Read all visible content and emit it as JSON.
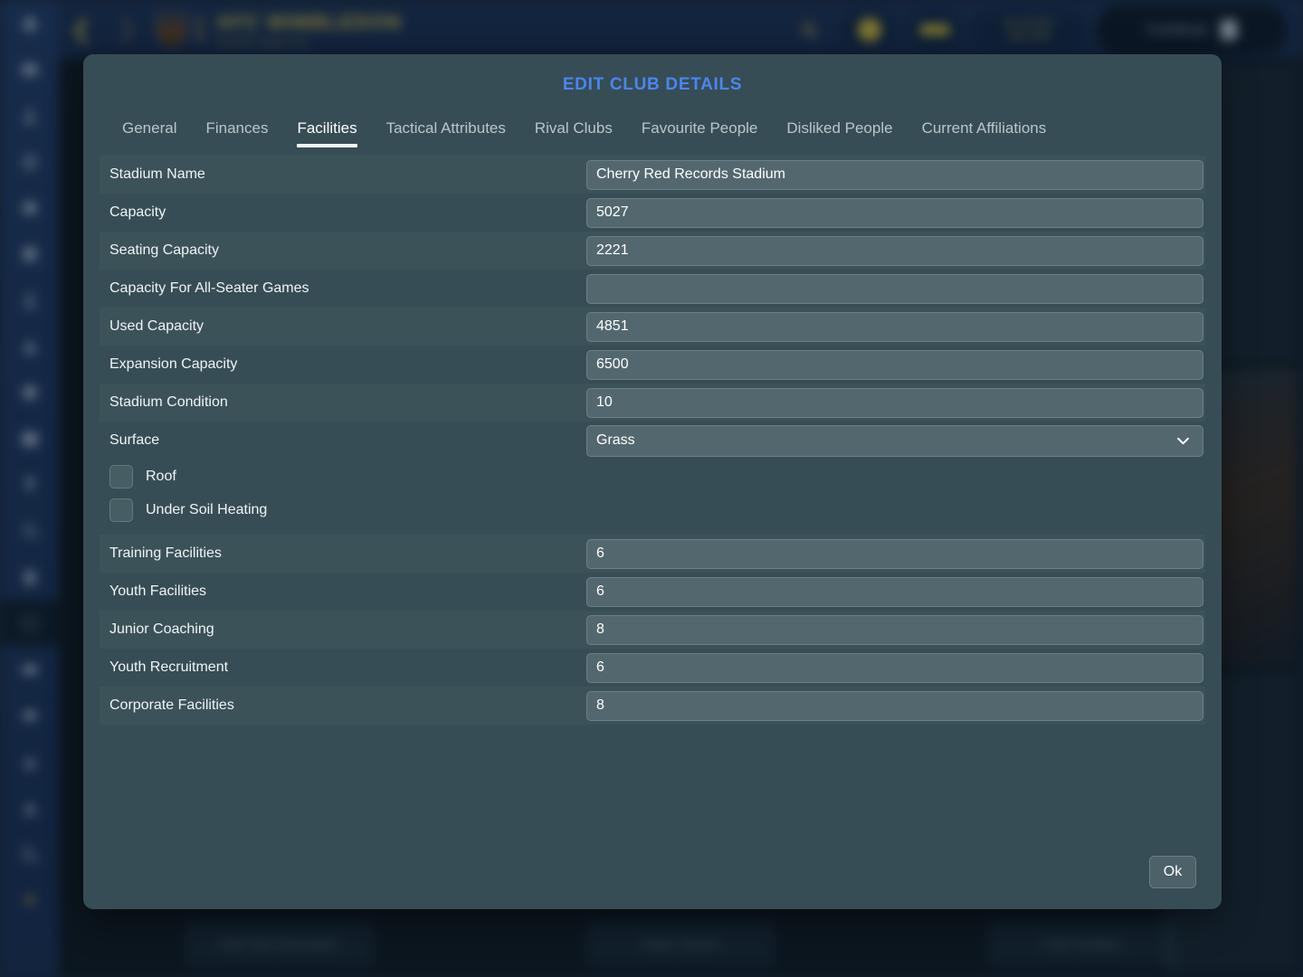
{
  "background": {
    "club_name": "AFC WIMBLEDON",
    "club_subtitle": "Sky Bet League One",
    "nav_back_icon": "chevron-left-icon",
    "nav_forward_icon": "chevron-right-icon",
    "search_icon": "search-icon",
    "date_line1": "15 Jul 2017",
    "date_line2": "Mon 15th",
    "continue_label": "Continue",
    "sidebar_icons": [
      "home-icon",
      "inbox-icon",
      "person-icon",
      "globe-icon",
      "squad-icon",
      "tactics-icon",
      "training-icon",
      "person-group-icon",
      "cone-icon",
      "shield-icon",
      "calendar-icon",
      "trophy-icon",
      "search-icon",
      "clipboard-icon",
      "club-icon",
      "tv-icon",
      "stadium-icon",
      "staff-icon",
      "scout-icon",
      "moon-icon",
      "settings-icon"
    ],
    "bottom_buttons": [
      "Edit Club Information",
      "Player Search",
      "Club Facilities"
    ]
  },
  "dialog": {
    "title": "EDIT CLUB DETAILS",
    "tabs": [
      {
        "label": "General",
        "active": false
      },
      {
        "label": "Finances",
        "active": false
      },
      {
        "label": "Facilities",
        "active": true
      },
      {
        "label": "Tactical Attributes",
        "active": false
      },
      {
        "label": "Rival Clubs",
        "active": false
      },
      {
        "label": "Favourite People",
        "active": false
      },
      {
        "label": "Disliked People",
        "active": false
      },
      {
        "label": "Current Affiliations",
        "active": false
      }
    ],
    "fields_top": [
      {
        "label": "Stadium Name",
        "value": "Cherry Red Records Stadium"
      },
      {
        "label": "Capacity",
        "value": "5027"
      },
      {
        "label": "Seating Capacity",
        "value": "2221"
      },
      {
        "label": "Capacity For All-Seater Games",
        "value": ""
      },
      {
        "label": "Used Capacity",
        "value": "4851"
      },
      {
        "label": "Expansion Capacity",
        "value": "6500"
      },
      {
        "label": "Stadium Condition",
        "value": "10"
      }
    ],
    "surface": {
      "label": "Surface",
      "value": "Grass",
      "chevron_icon": "chevron-down-icon"
    },
    "checkboxes": [
      {
        "label": "Roof",
        "checked": false
      },
      {
        "label": "Under Soil Heating",
        "checked": false
      }
    ],
    "fields_bottom": [
      {
        "label": "Training Facilities",
        "value": "6"
      },
      {
        "label": "Youth Facilities",
        "value": "6"
      },
      {
        "label": "Junior Coaching",
        "value": "8"
      },
      {
        "label": "Youth Recruitment",
        "value": "6"
      },
      {
        "label": "Corporate Facilities",
        "value": "8"
      }
    ],
    "ok_label": "Ok"
  },
  "colors": {
    "title_blue": "#4a86f0",
    "dialog_bg": "#374d55",
    "row_odd": "#3b5259",
    "row_even": "#374d55",
    "field_bg": "#53686e",
    "accent_yellow": "#d8c64f",
    "topbar_blue": "#1d3459"
  }
}
